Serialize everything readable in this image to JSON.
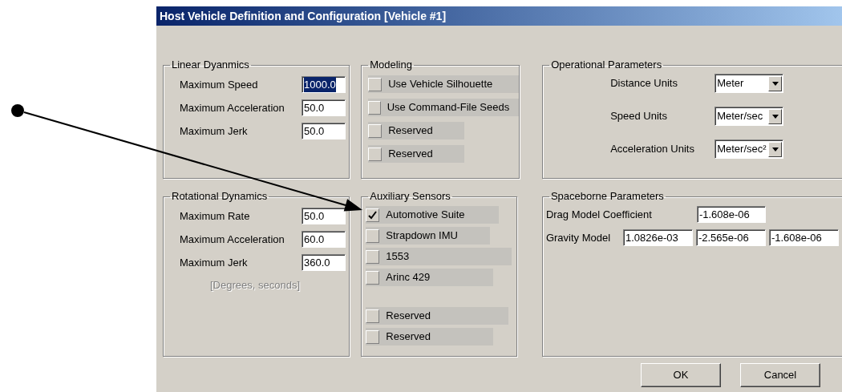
{
  "window": {
    "title": "Host Vehicle Definition and Configuration [Vehicle #1]"
  },
  "linear_dynamics": {
    "title": "Linear Dyanmics",
    "fields": [
      {
        "label": "Maximum Speed",
        "value": "1000.0",
        "text_selected": true
      },
      {
        "label": "Maximum Acceleration",
        "value": "50.0",
        "text_selected": false
      },
      {
        "label": "Maximum Jerk",
        "value": "50.0",
        "text_selected": false
      }
    ]
  },
  "modeling": {
    "title": "Modeling",
    "options": [
      {
        "label": "Use Vehicle Silhouette",
        "checked": false
      },
      {
        "label": "Use Command-File Seeds",
        "checked": false
      },
      {
        "label": "Reserved",
        "checked": false
      },
      {
        "label": "Reserved",
        "checked": false
      }
    ]
  },
  "operational_parameters": {
    "title": "Operational Parameters",
    "selects": [
      {
        "label": "Distance Units",
        "value": "Meter"
      },
      {
        "label": "Speed Units",
        "value": "Meter/sec"
      },
      {
        "label": "Acceleration Units",
        "value": "Meter/sec²"
      }
    ]
  },
  "rotational_dynamics": {
    "title": "Rotational Dynamics",
    "fields": [
      {
        "label": "Maximum Rate",
        "value": "50.0",
        "text_selected": false
      },
      {
        "label": "Maximum Acceleration",
        "value": "60.0",
        "text_selected": false
      },
      {
        "label": "Maximum Jerk",
        "value": "360.0",
        "text_selected": false
      }
    ],
    "note": "[Degrees, seconds]"
  },
  "auxiliary_sensors": {
    "title": "Auxiliary Sensors",
    "groups": [
      {
        "options": [
          {
            "label": "Automotive Suite",
            "checked": true
          },
          {
            "label": "Strapdown IMU",
            "checked": false
          },
          {
            "label": "1553",
            "checked": false
          },
          {
            "label": "Arinc 429",
            "checked": false
          }
        ]
      },
      {
        "options": [
          {
            "label": "Reserved",
            "checked": false
          },
          {
            "label": "Reserved",
            "checked": false
          }
        ]
      }
    ]
  },
  "spaceborne_parameters": {
    "title": "Spaceborne Parameters",
    "drag": {
      "label": "Drag Model Coefficient",
      "value": "-1.608e-06"
    },
    "gravity": {
      "label": "Gravity Model",
      "values": [
        "1.0826e-03",
        "-2.565e-06",
        "-1.608e-06"
      ]
    }
  },
  "buttons": [
    "OK",
    "Cancel"
  ]
}
